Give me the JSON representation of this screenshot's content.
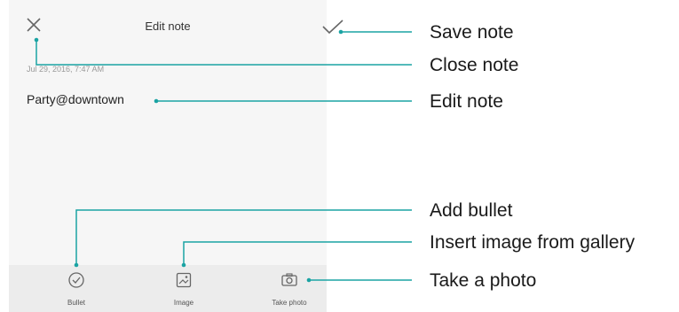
{
  "header": {
    "title": "Edit note"
  },
  "note": {
    "date": "Jul 29, 2016, 7:47 AM",
    "text": "Party@downtown"
  },
  "toolbar": [
    {
      "label": "Bullet",
      "icon": "check-circle-icon"
    },
    {
      "label": "Image",
      "icon": "image-icon"
    },
    {
      "label": "Take photo",
      "icon": "camera-icon"
    }
  ],
  "callouts": {
    "save": "Save note",
    "close": "Close note",
    "edit": "Edit note",
    "bullet": "Add bullet",
    "image": "Insert image from gallery",
    "photo": "Take a photo"
  },
  "colors": {
    "callout_line": "#1aa3a3",
    "icon": "#666666"
  }
}
